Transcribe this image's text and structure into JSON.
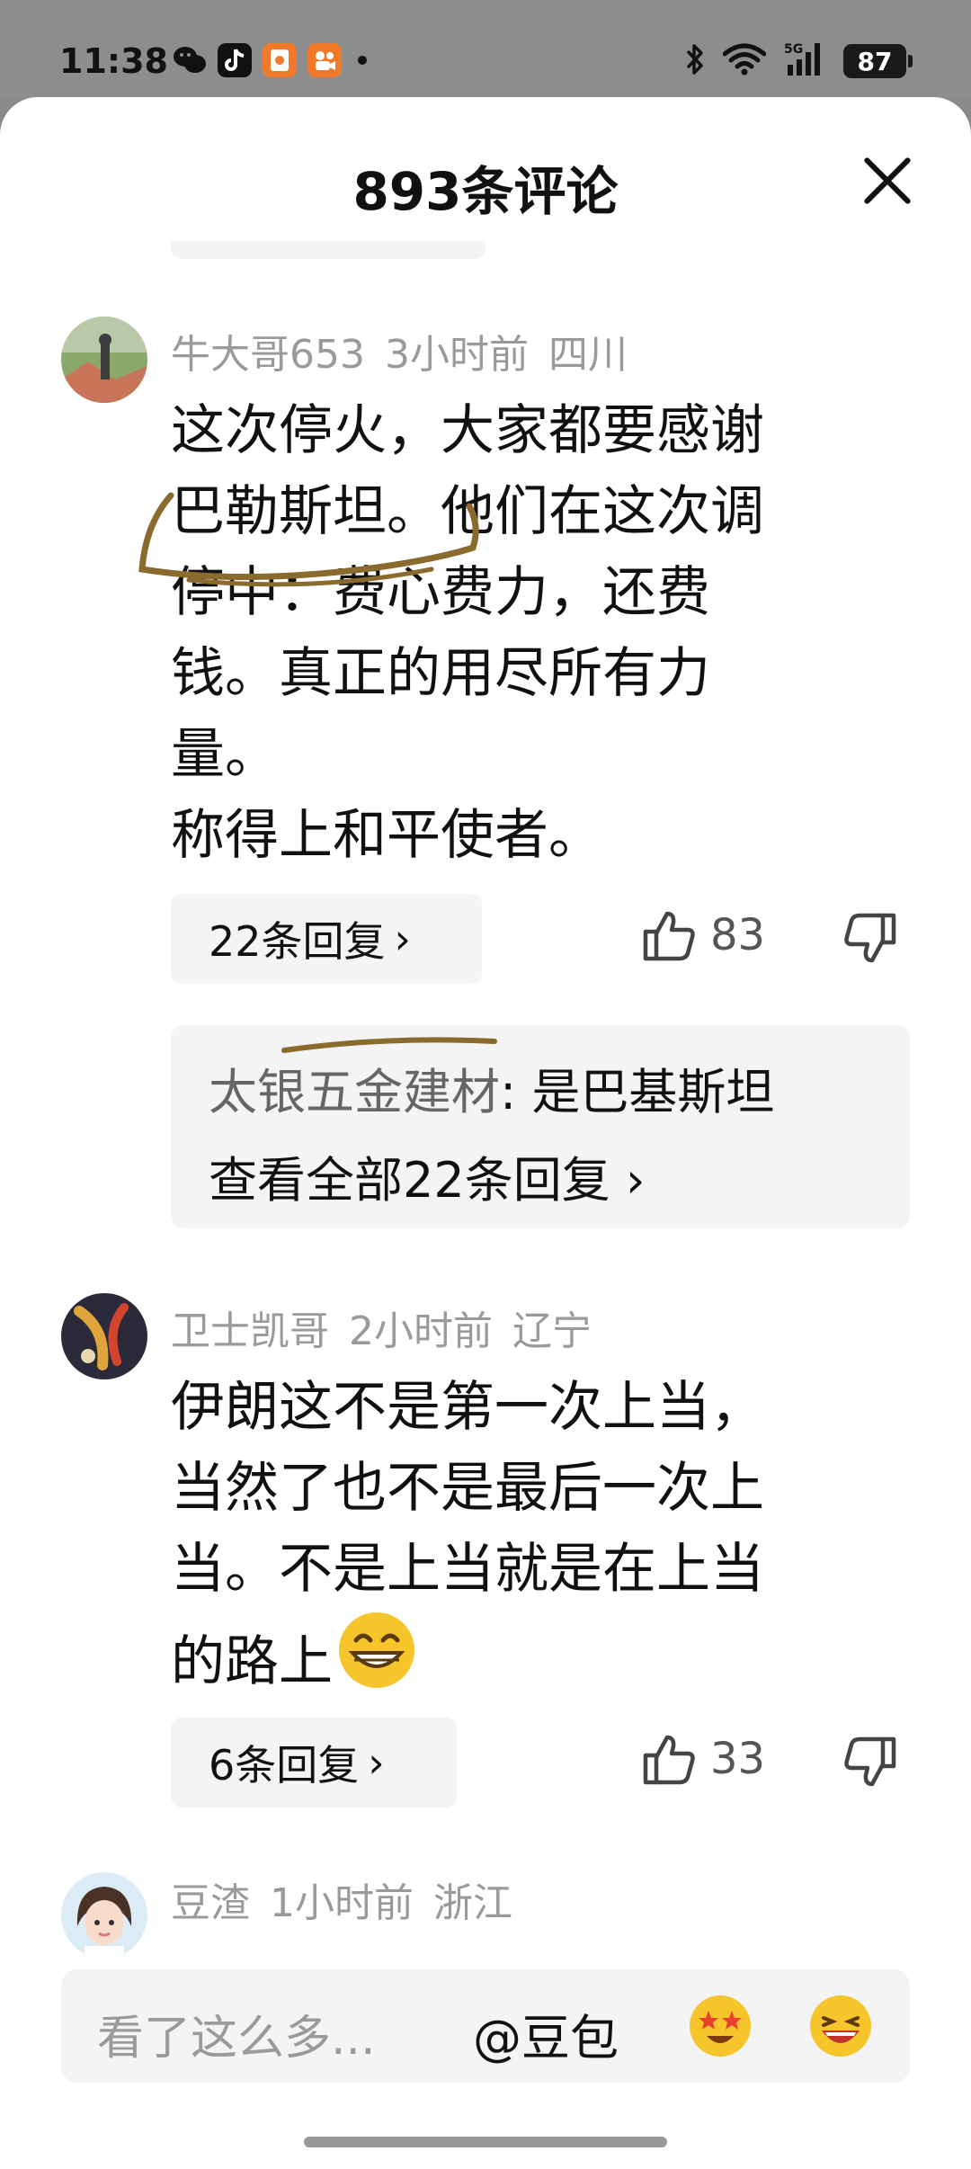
{
  "status_bar": {
    "time": "11:38",
    "battery": "87",
    "apps": [
      "wechat-icon",
      "tiktok-icon",
      "red-packet-icon",
      "kuaishou-icon"
    ]
  },
  "sheet": {
    "title": "893条评论"
  },
  "comments": [
    {
      "username": "牛大哥653",
      "time": "3小时前",
      "location": "四川",
      "lines": [
        "这次停火，大家都要感谢",
        "巴勒斯坦。他们在这次调",
        "停中：费心费力，还费",
        "钱。真正的用尽所有力",
        "量。",
        "称得上和平使者。"
      ],
      "replies_label": "22条回复",
      "likes": "83",
      "reply_preview": {
        "author": "太银五金建材",
        "text": ": 是巴基斯坦",
        "view_all": "查看全部22条回复"
      }
    },
    {
      "username": "卫士凯哥",
      "time": "2小时前",
      "location": "辽宁",
      "lines": [
        "伊朗这不是第一次上当，",
        "当然了也不是最后一次上",
        "当。不是上当就是在上当",
        "的路上"
      ],
      "replies_label": "6条回复",
      "likes": "33"
    },
    {
      "username": "豆渣",
      "time": "1小时前",
      "location": "浙江"
    }
  ],
  "input_bar": {
    "placeholder": "看了这么多...",
    "mention": "@豆包"
  },
  "colors": {
    "meta_gray": "#9a9a9a",
    "panel_bg": "#f4f4f5",
    "ink_mark": "#8b6a2e"
  }
}
